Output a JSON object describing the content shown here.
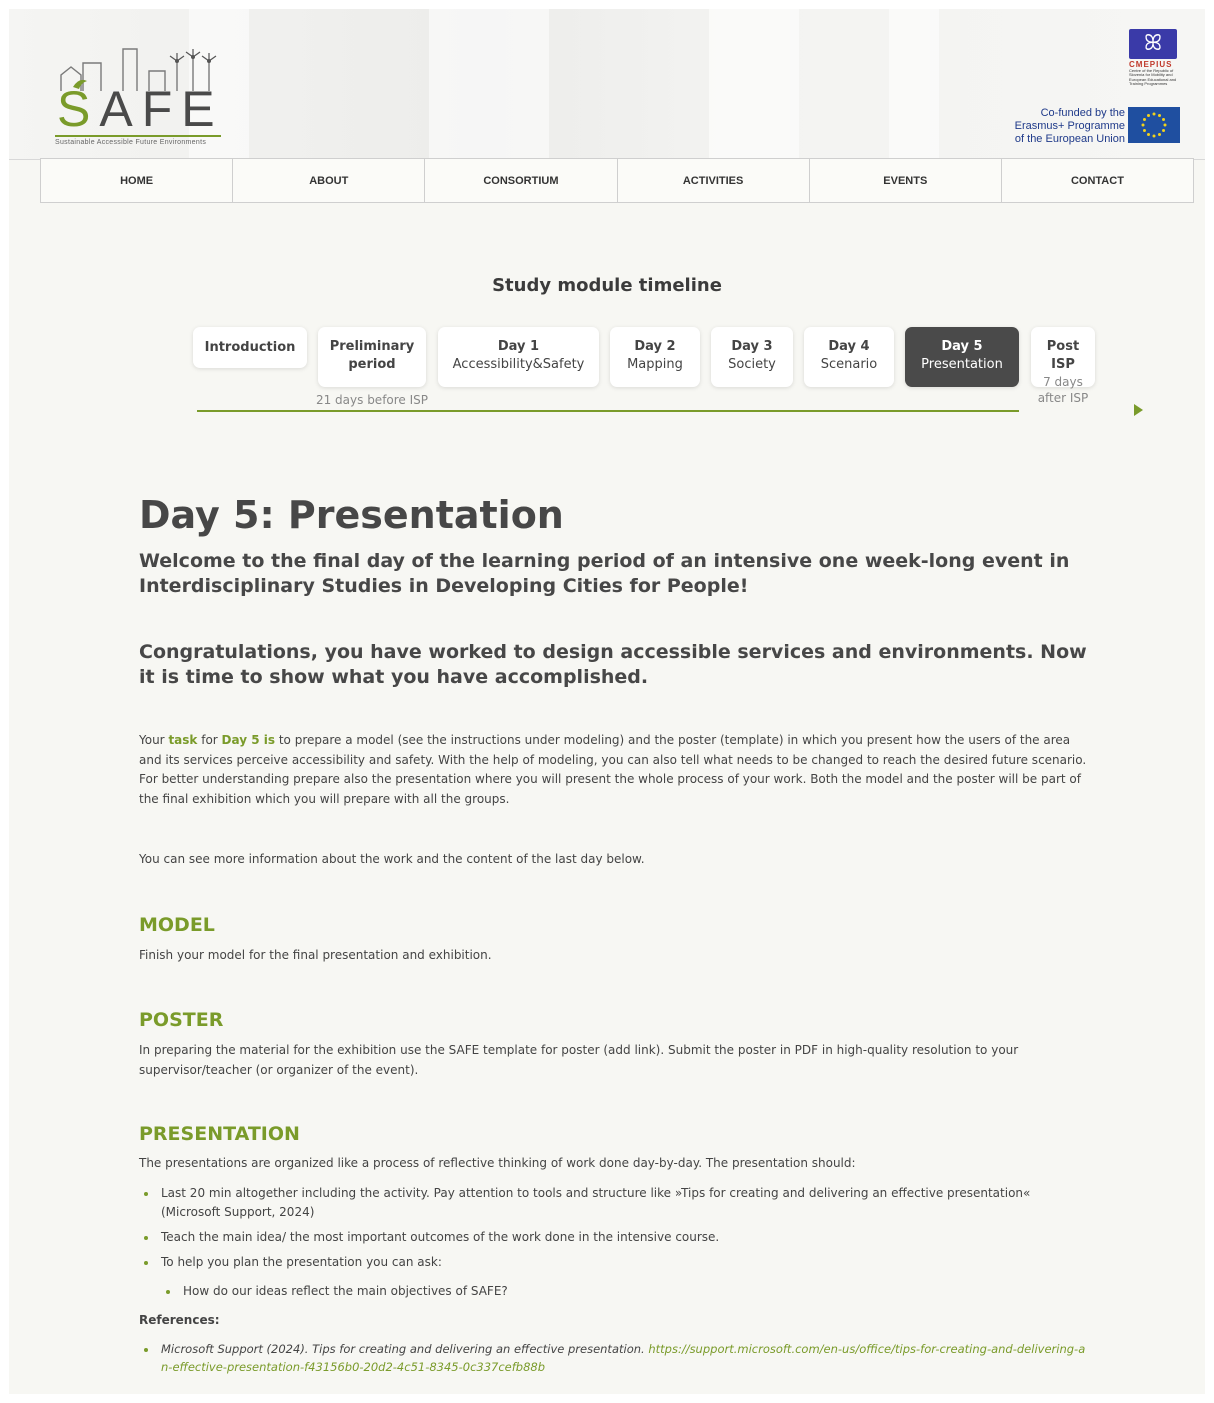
{
  "header": {
    "logo": {
      "letters": [
        "S",
        "A",
        "F",
        "E"
      ],
      "tagline": "Sustainable   Accessible   Future   Environments"
    },
    "cmepius": {
      "name": "CMEPIUS",
      "description": "Centre of the Republic of Slovenia for Mobility and European Educational and Training Programmes"
    },
    "erasmus": {
      "lines": [
        "Co-funded by the",
        "Erasmus+ Programme",
        "of the European Union"
      ]
    }
  },
  "nav": {
    "items": [
      "HOME",
      "ABOUT",
      "CONSORTIUM",
      "ACTIVITIES",
      "EVENTS",
      "CONTACT"
    ]
  },
  "timeline": {
    "title": "Study module timeline",
    "cards": [
      {
        "line1": "Introduction",
        "line2": ""
      },
      {
        "line1": "Preliminary",
        "line2": "period"
      },
      {
        "line1": "Day 1",
        "line2": "Accessibility&Safety"
      },
      {
        "line1": "Day 2",
        "line2": "Mapping"
      },
      {
        "line1": "Day 3",
        "line2": "Society"
      },
      {
        "line1": "Day 4",
        "line2": "Scenario"
      },
      {
        "line1": "Day 5",
        "line2": "Presentation"
      },
      {
        "line1": "Post",
        "line2": "ISP"
      }
    ],
    "active": "Day 5",
    "preliminary_note": "21 days before ISP",
    "post_note_1": "7 days",
    "post_note_2": "after ISP"
  },
  "content": {
    "title": "Day 5: Presentation",
    "welcome": "Welcome to the final day of the learning period of an intensive one week-long event in Interdisciplinary Studies in Developing Cities for People!",
    "congrats": " Congratulations, you have worked to design accessible services and environments. Now it is time to show what you have accomplished.",
    "task": {
      "w1": "Your ",
      "w2": "task",
      "w3": " for ",
      "w4": "Day 5 is",
      "rest": " to prepare a model (see the instructions under modeling) and the poster (template) in which you present how the users of the area and its services perceive accessibility and safety. With the help of modeling, you can also tell what needs to be changed to reach the desired future scenario. For better understanding prepare also the presentation where you will present the whole process of your work. Both the model and the poster will be part of the final exhibition which you will prepare with all the groups."
    },
    "more_info": "You can see more information about the work and the content of the last day below.",
    "model": {
      "heading": "MODEL",
      "text": "Finish your model for the final presentation and exhibition."
    },
    "poster": {
      "heading": "POSTER",
      "text": "In preparing the material for the exhibition use the SAFE template for poster (add link). Submit the poster in PDF in high-quality resolution to your supervisor/teacher (or organizer of the event)."
    },
    "presentation": {
      "heading": "PRESENTATION",
      "intro": "The presentations are organized like a process of reflective thinking of work done day-by-day. The presentation should:",
      "bullets": [
        "Last 20 min altogether including the activity. Pay attention to tools and structure like »Tips for creating and delivering an effective presentation« (Microsoft Support, 2024)",
        "Teach the main idea/ the most important outcomes of the work done in the intensive course.",
        "To help you plan the presentation you can ask:"
      ],
      "sub_bullets": [
        "How do our ideas reflect the main objectives of SAFE?"
      ]
    },
    "references": {
      "heading": "References:",
      "ref_text": "Microsoft Support (2024). Tips for creating and delivering an effective presentation. ",
      "ref_link": "https://support.microsoft.com/en-us/office/tips-for-creating-and-delivering-an-effective-presentation-f43156b0-20d2-4c51-8345-0c337cefb88b"
    }
  },
  "colors": {
    "accent": "#7a9b2a",
    "text": "#474747",
    "active_card": "#4a4a4a",
    "eu_blue": "#1f4fa0",
    "eu_star": "#f2d21b"
  }
}
